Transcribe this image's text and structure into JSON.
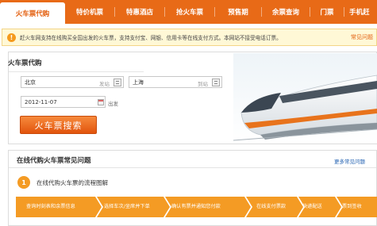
{
  "nav": {
    "items": [
      {
        "label": "火车票代购"
      },
      {
        "label": "特价机票"
      },
      {
        "label": "特惠酒店"
      },
      {
        "label": "抢火车票"
      },
      {
        "label": "预售期"
      },
      {
        "label": "余票查询"
      },
      {
        "label": "门票"
      },
      {
        "label": "手机赶"
      }
    ]
  },
  "notice": {
    "text": "赶火车网支持在线购买全国出发的火车票，支持支付宝、网银、信用卡等在线支付方式。本网站不接受电话订票。",
    "link": "常见问题"
  },
  "booking": {
    "title": "火车票代购",
    "from_value": "北京",
    "from_placeholder": "发站",
    "to_value": "上海",
    "to_placeholder": "到站",
    "date_value": "2012-11-07",
    "date_suffix": "出发",
    "search_label": "火车票搜索"
  },
  "faq": {
    "title": "在线代购火车票常见问题",
    "more_link": "更多常见问题",
    "step_number": "1",
    "step_title": "在线代购火车票的流程图解",
    "steps": [
      {
        "label": "查询时刻表和余票信息"
      },
      {
        "label": "选择车次/坐席并下单"
      },
      {
        "label": "确认有票并通知您付款"
      },
      {
        "label": "在线支付票款"
      },
      {
        "label": "快递配送"
      },
      {
        "label": "票到签收"
      }
    ]
  },
  "colors": {
    "accent": "#e86a17",
    "step_bg": "#f49b24",
    "notice_bg": "#fff8d6"
  }
}
